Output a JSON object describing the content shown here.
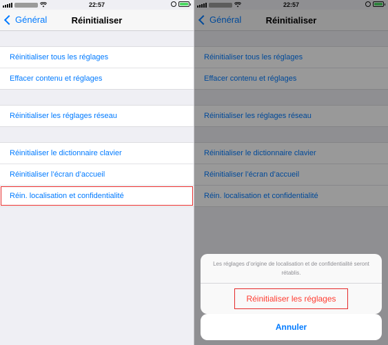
{
  "status": {
    "time": "22:57"
  },
  "nav": {
    "back": "Général",
    "title": "Réinitialiser"
  },
  "groups": {
    "g1": [
      "Réinitialiser tous les réglages",
      "Effacer contenu et réglages"
    ],
    "g2": [
      "Réinitialiser les réglages réseau"
    ],
    "g3": [
      "Réinitialiser le dictionnaire clavier",
      "Réinitialiser l’écran d’accueil",
      "Réin. localisation et confidentialité"
    ]
  },
  "action_sheet": {
    "message": "Les réglages d’origine de localisation et de confidentialité seront rétablis.",
    "confirm": "Réinitialiser les réglages",
    "cancel": "Annuler"
  },
  "colors": {
    "link": "#007aff",
    "destructive": "#ff3b30",
    "highlight": "#e52828",
    "battery": "#4cd964"
  },
  "icons": [
    "signal-bars-icon",
    "wifi-icon",
    "orientation-lock-icon",
    "battery-icon",
    "chevron-left-icon"
  ]
}
